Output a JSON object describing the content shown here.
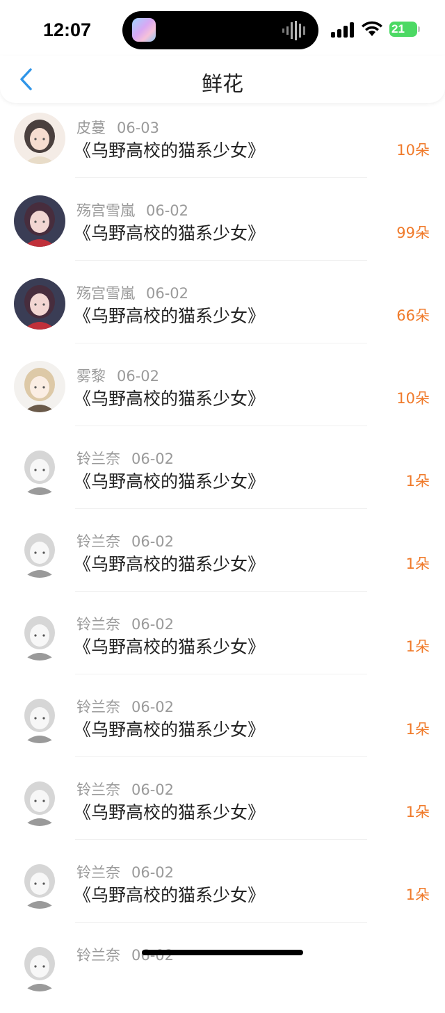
{
  "status_bar": {
    "time": "12:07",
    "battery": "21"
  },
  "nav": {
    "title": "鲜花",
    "back_icon": "chevron-left-icon"
  },
  "colors": {
    "accent": "#f07a2a",
    "back": "#2f95e8"
  },
  "items": [
    {
      "user": "皮蔓",
      "date": "06-03",
      "book": "《乌野高校的猫系少女》",
      "amount": "10朵"
    },
    {
      "user": "殇宫雪嵐",
      "date": "06-02",
      "book": "《乌野高校的猫系少女》",
      "amount": "99朵"
    },
    {
      "user": "殇宫雪嵐",
      "date": "06-02",
      "book": "《乌野高校的猫系少女》",
      "amount": "66朵"
    },
    {
      "user": "雾黎",
      "date": "06-02",
      "book": "《乌野高校的猫系少女》",
      "amount": "10朵"
    },
    {
      "user": "铃兰奈",
      "date": "06-02",
      "book": "《乌野高校的猫系少女》",
      "amount": "1朵"
    },
    {
      "user": "铃兰奈",
      "date": "06-02",
      "book": "《乌野高校的猫系少女》",
      "amount": "1朵"
    },
    {
      "user": "铃兰奈",
      "date": "06-02",
      "book": "《乌野高校的猫系少女》",
      "amount": "1朵"
    },
    {
      "user": "铃兰奈",
      "date": "06-02",
      "book": "《乌野高校的猫系少女》",
      "amount": "1朵"
    },
    {
      "user": "铃兰奈",
      "date": "06-02",
      "book": "《乌野高校的猫系少女》",
      "amount": "1朵"
    },
    {
      "user": "铃兰奈",
      "date": "06-02",
      "book": "《乌野高校的猫系少女》",
      "amount": "1朵"
    },
    {
      "user": "铃兰奈",
      "date": "06-02",
      "book": "",
      "amount": ""
    }
  ]
}
